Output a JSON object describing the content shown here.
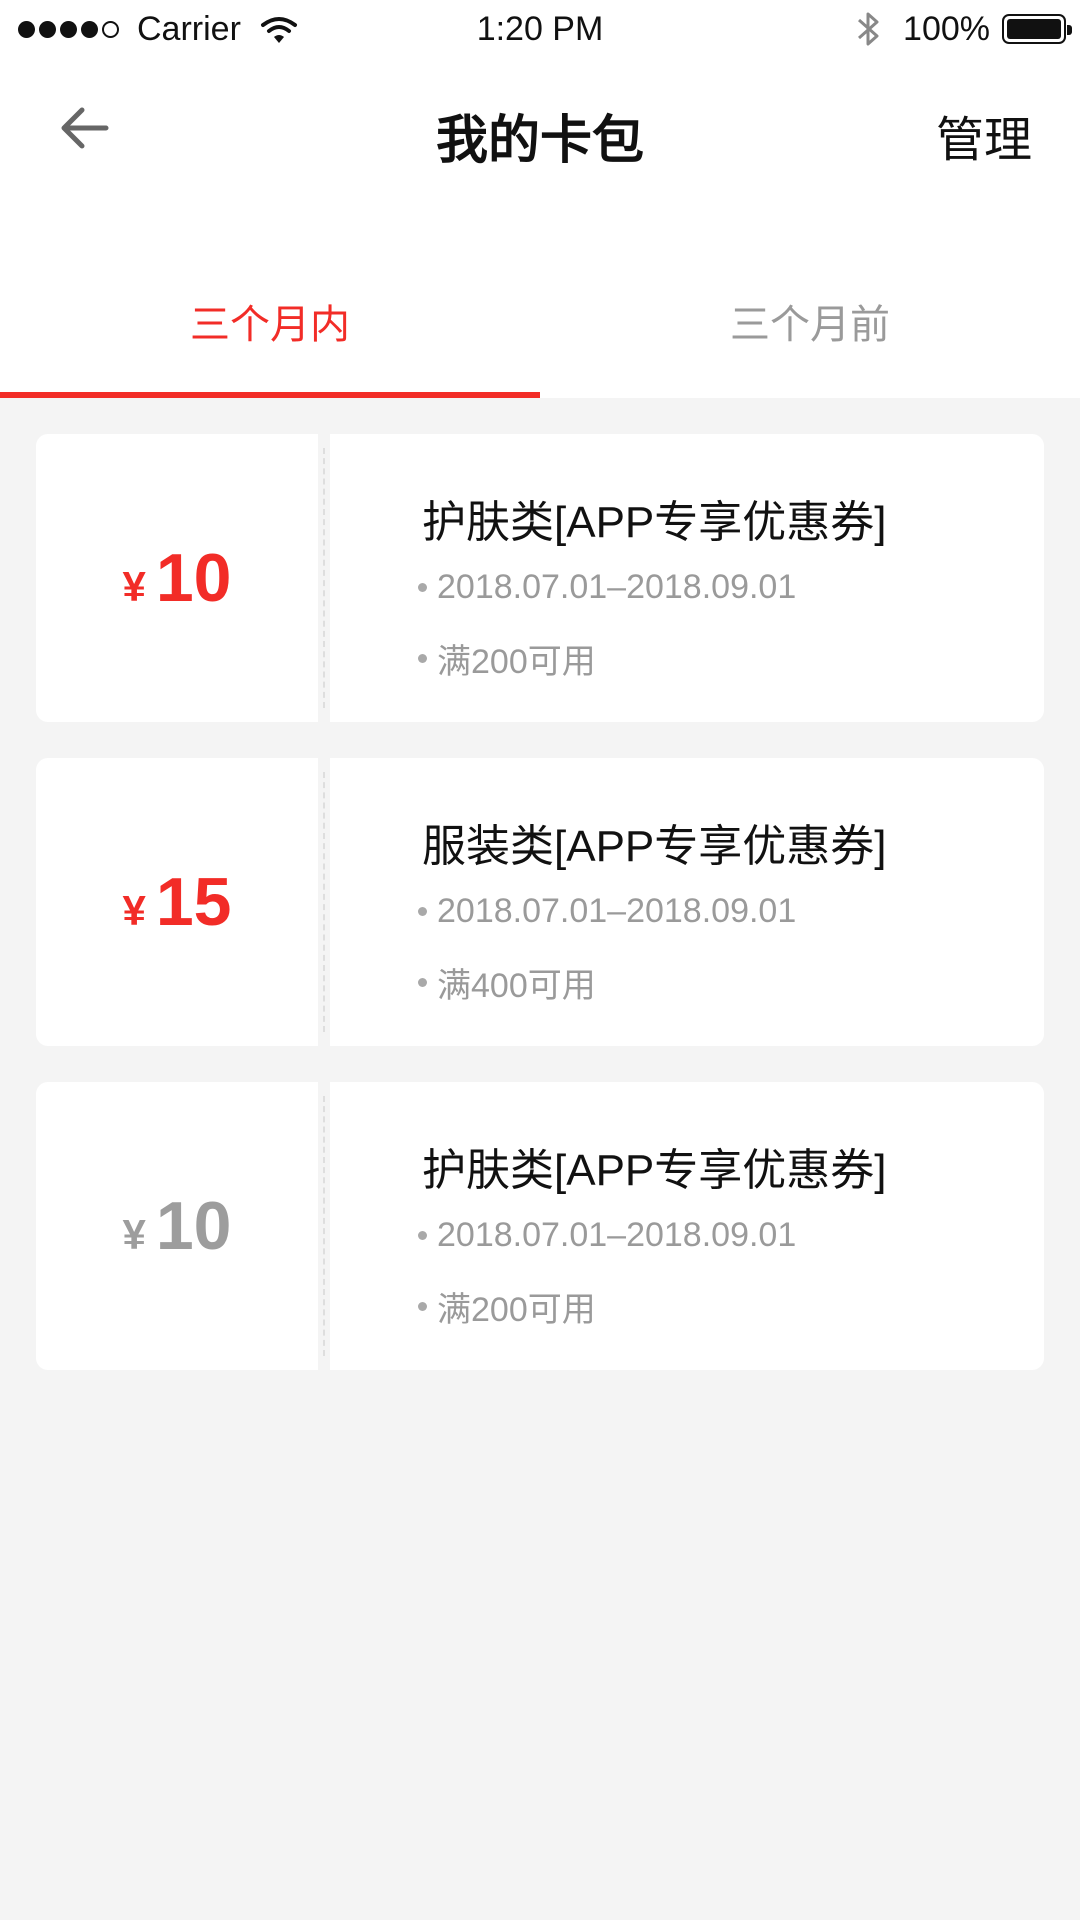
{
  "status_bar": {
    "carrier": "Carrier",
    "time": "1:20 PM",
    "battery": "100%"
  },
  "nav": {
    "title": "我的卡包",
    "manage_label": "管理"
  },
  "tabs": [
    {
      "label": "三个月内",
      "active": true
    },
    {
      "label": "三个月前",
      "active": false
    }
  ],
  "coupons": [
    {
      "currency": "¥",
      "value": "10",
      "title": "护肤类[APP专享优惠券]",
      "validity": "2018.07.01–2018.09.01",
      "condition": "满200可用",
      "status": "active"
    },
    {
      "currency": "¥",
      "value": "15",
      "title": "服装类[APP专享优惠券]",
      "validity": "2018.07.01–2018.09.01",
      "condition": "满400可用",
      "status": "active"
    },
    {
      "currency": "¥",
      "value": "10",
      "title": "护肤类[APP专享优惠券]",
      "validity": "2018.07.01–2018.09.01",
      "condition": "满200可用",
      "status": "inactive"
    }
  ],
  "colors": {
    "accent": "#f22c27",
    "inactive_text": "#9a9a9a",
    "background": "#f4f4f4"
  },
  "icons": [
    "back-arrow-icon",
    "wifi-icon",
    "bluetooth-icon",
    "battery-icon"
  ]
}
